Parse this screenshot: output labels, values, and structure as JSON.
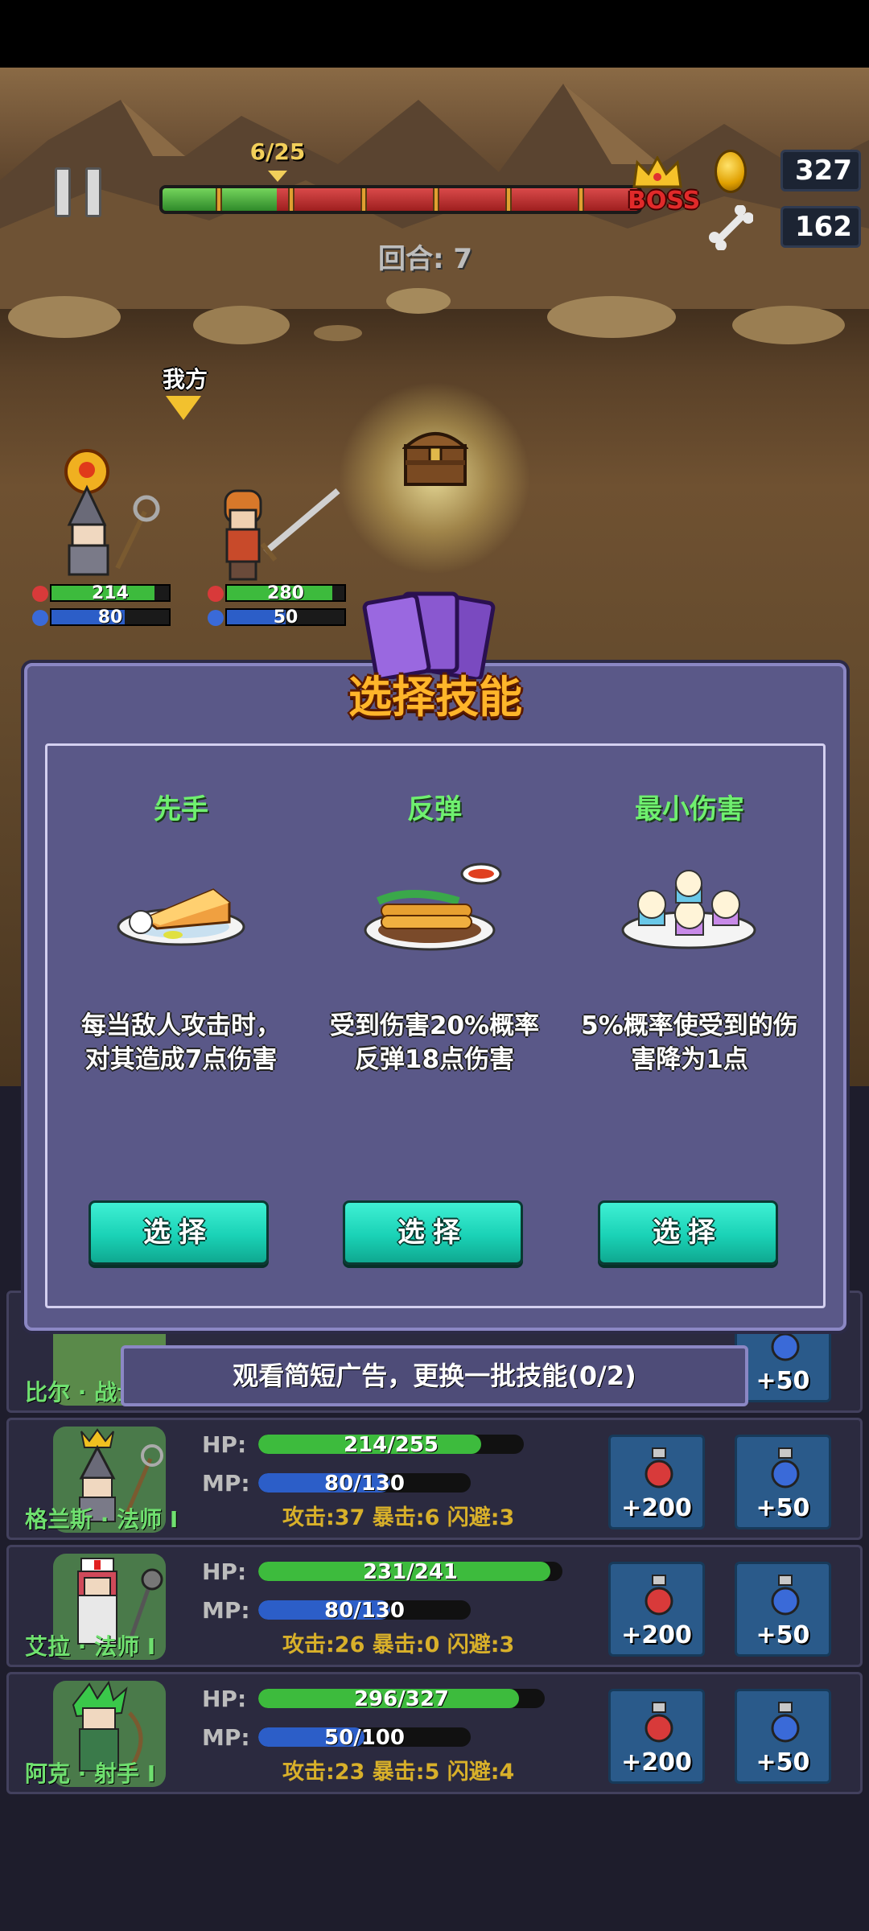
{
  "hud": {
    "wave": "6/25",
    "wave_progress": 0.24,
    "boss_label": "BOSS",
    "gold": "327",
    "bones": "162",
    "round": "回合: 7"
  },
  "battle": {
    "ally_label": "我方",
    "heroes": [
      {
        "hp": "214",
        "mp": "80"
      },
      {
        "hp": "280",
        "mp": "50"
      }
    ]
  },
  "dialog": {
    "title": "选择技能",
    "skills": [
      {
        "name": "先手",
        "desc": "每当敌人攻击时，对其造成7点伤害",
        "button": "选择",
        "image": "toast-dish-icon"
      },
      {
        "name": "反弹",
        "desc": "受到伤害20%概率反弹18点伤害",
        "button": "选择",
        "image": "spring-rolls-dish-icon"
      },
      {
        "name": "最小伤害",
        "desc": "5%概率使受到的伤害降为1点",
        "button": "选择",
        "image": "cupcakes-plate-icon"
      }
    ],
    "ad_button": "观看简短广告，更换一批技能(0/2)"
  },
  "party": [
    {
      "name": "比尔 · 战士 Ⅰ",
      "hp": "",
      "mp": ""
    },
    {
      "name": "格兰斯 · 法师 Ⅰ",
      "hp_label": "HP:",
      "mp_label": "MP:",
      "hp": "214/255",
      "hp_fraction": 0.84,
      "mp": "80/130",
      "mp_fraction": 0.62,
      "stats": "攻击:37  暴击:6  闪避:3",
      "hp_potion": "+200",
      "mp_potion": "+50"
    },
    {
      "name": "艾拉 · 法师 Ⅰ",
      "hp_label": "HP:",
      "mp_label": "MP:",
      "hp": "231/241",
      "hp_fraction": 0.96,
      "mp": "80/130",
      "mp_fraction": 0.62,
      "stats": "攻击:26  暴击:0  闪避:3",
      "hp_potion": "+200",
      "mp_potion": "+50"
    },
    {
      "name": "阿克 · 射手 Ⅰ",
      "hp_label": "HP:",
      "mp_label": "MP:",
      "hp": "296/327",
      "hp_fraction": 0.91,
      "mp": "50/100",
      "mp_fraction": 0.5,
      "stats": "攻击:23  暴击:5  闪避:4",
      "hp_potion": "+200",
      "mp_potion": "+50"
    }
  ],
  "party_first_mp_potion": "+50",
  "colors": {
    "hp_green": "#3dbb3d",
    "mp_blue": "#2c5ec8",
    "dialog_bg": "#5a5888",
    "select_button": "#1ad2b6",
    "title_orange": "#ffb52a"
  }
}
